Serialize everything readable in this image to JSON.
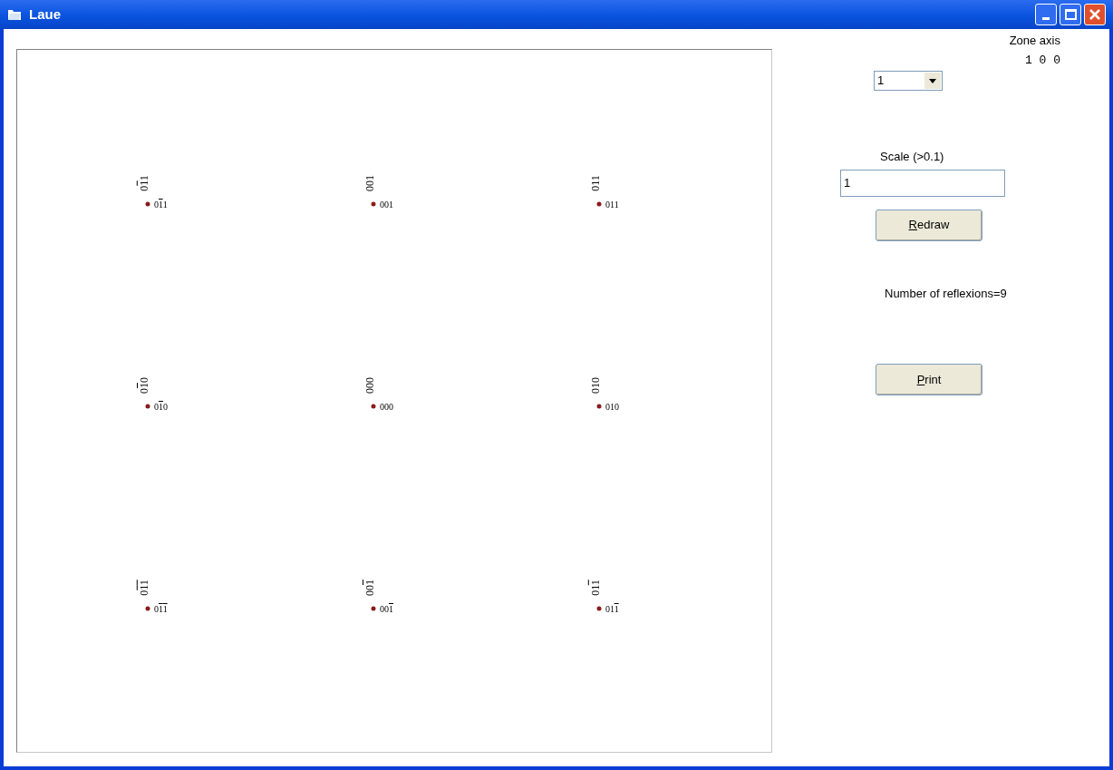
{
  "window": {
    "title": "Laue"
  },
  "spots": [
    {
      "vertical_label": [
        {
          "digit": "0",
          "bar": false
        },
        {
          "digit": "1",
          "bar": true
        },
        {
          "digit": "1",
          "bar": false
        }
      ],
      "label": [
        {
          "digit": "0",
          "bar": false
        },
        {
          "digit": "1",
          "bar": true
        },
        {
          "digit": "1",
          "bar": false
        }
      ]
    },
    {
      "vertical_label": [
        {
          "digit": "0",
          "bar": false
        },
        {
          "digit": "0",
          "bar": false
        },
        {
          "digit": "1",
          "bar": false
        }
      ],
      "label": [
        {
          "digit": "0",
          "bar": false
        },
        {
          "digit": "0",
          "bar": false
        },
        {
          "digit": "1",
          "bar": false
        }
      ]
    },
    {
      "vertical_label": [
        {
          "digit": "0",
          "bar": false
        },
        {
          "digit": "1",
          "bar": false
        },
        {
          "digit": "1",
          "bar": false
        }
      ],
      "label": [
        {
          "digit": "0",
          "bar": false
        },
        {
          "digit": "1",
          "bar": false
        },
        {
          "digit": "1",
          "bar": false
        }
      ]
    },
    {
      "vertical_label": [
        {
          "digit": "0",
          "bar": false
        },
        {
          "digit": "1",
          "bar": true
        },
        {
          "digit": "0",
          "bar": false
        }
      ],
      "label": [
        {
          "digit": "0",
          "bar": false
        },
        {
          "digit": "1",
          "bar": true
        },
        {
          "digit": "0",
          "bar": false
        }
      ]
    },
    {
      "vertical_label": [
        {
          "digit": "0",
          "bar": false
        },
        {
          "digit": "0",
          "bar": false
        },
        {
          "digit": "0",
          "bar": false
        }
      ],
      "label": [
        {
          "digit": "0",
          "bar": false
        },
        {
          "digit": "0",
          "bar": false
        },
        {
          "digit": "0",
          "bar": false
        }
      ]
    },
    {
      "vertical_label": [
        {
          "digit": "0",
          "bar": false
        },
        {
          "digit": "1",
          "bar": false
        },
        {
          "digit": "0",
          "bar": false
        }
      ],
      "label": [
        {
          "digit": "0",
          "bar": false
        },
        {
          "digit": "1",
          "bar": false
        },
        {
          "digit": "0",
          "bar": false
        }
      ]
    },
    {
      "vertical_label": [
        {
          "digit": "0",
          "bar": false
        },
        {
          "digit": "1",
          "bar": true
        },
        {
          "digit": "1",
          "bar": true
        }
      ],
      "label": [
        {
          "digit": "0",
          "bar": false
        },
        {
          "digit": "1",
          "bar": true
        },
        {
          "digit": "1",
          "bar": true
        }
      ]
    },
    {
      "vertical_label": [
        {
          "digit": "0",
          "bar": false
        },
        {
          "digit": "0",
          "bar": false
        },
        {
          "digit": "1",
          "bar": true
        }
      ],
      "label": [
        {
          "digit": "0",
          "bar": false
        },
        {
          "digit": "0",
          "bar": false
        },
        {
          "digit": "1",
          "bar": true
        }
      ]
    },
    {
      "vertical_label": [
        {
          "digit": "0",
          "bar": false
        },
        {
          "digit": "1",
          "bar": false
        },
        {
          "digit": "1",
          "bar": true
        }
      ],
      "label": [
        {
          "digit": "0",
          "bar": false
        },
        {
          "digit": "1",
          "bar": false
        },
        {
          "digit": "1",
          "bar": true
        }
      ]
    }
  ],
  "zone_axis": {
    "label": "Zone axis",
    "value": "1 0 0",
    "dropdown": "1"
  },
  "scale": {
    "label": "Scale (>0.1)",
    "value": "1"
  },
  "buttons": [
    {
      "label": "Redraw"
    },
    {
      "label": "Print"
    }
  ],
  "reflexions": "Number of reflexions=9"
}
